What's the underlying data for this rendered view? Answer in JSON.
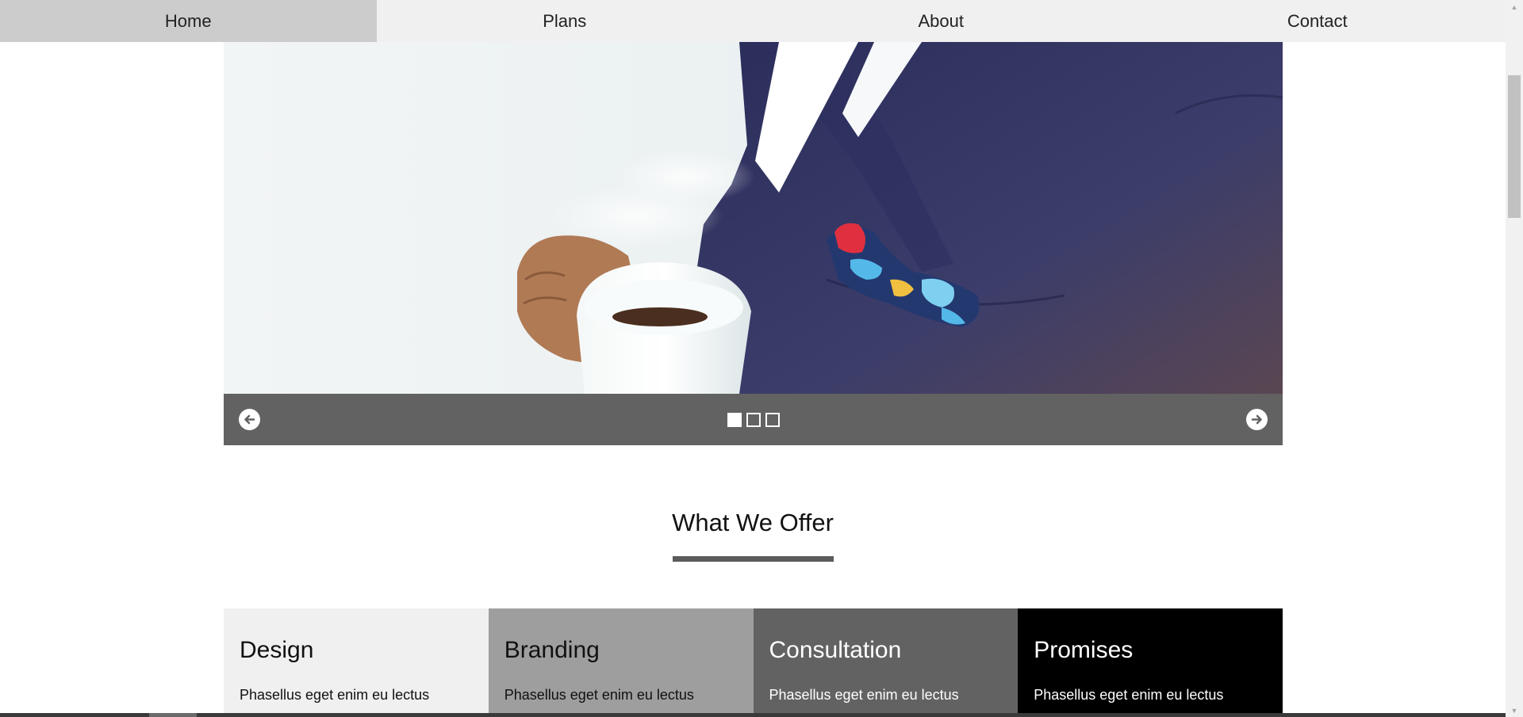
{
  "nav": {
    "items": [
      {
        "label": "Home",
        "active": true
      },
      {
        "label": "Plans",
        "active": false
      },
      {
        "label": "About",
        "active": false
      },
      {
        "label": "Contact",
        "active": false
      }
    ]
  },
  "slider": {
    "image_icon": "coffee-cup-suit-photo",
    "prev_icon": "arrow-left-circle-icon",
    "next_icon": "arrow-right-circle-icon",
    "slide_count": 3,
    "active_slide": 1
  },
  "offer": {
    "heading": "What We Offer",
    "cards": [
      {
        "title": "Design",
        "text": "Phasellus eget enim eu lectus",
        "color": "#f0f0f0"
      },
      {
        "title": "Branding",
        "text": "Phasellus eget enim eu lectus",
        "color": "#9e9e9e"
      },
      {
        "title": "Consultation",
        "text": "Phasellus eget enim eu lectus",
        "color": "#626262"
      },
      {
        "title": "Promises",
        "text": "Phasellus eget enim eu lectus",
        "color": "#000000"
      }
    ]
  },
  "colors": {
    "nav_bg": "#f0f0f0",
    "nav_active": "#cccccc",
    "slider_bar": "#626262",
    "underline": "#5b5b5b"
  }
}
